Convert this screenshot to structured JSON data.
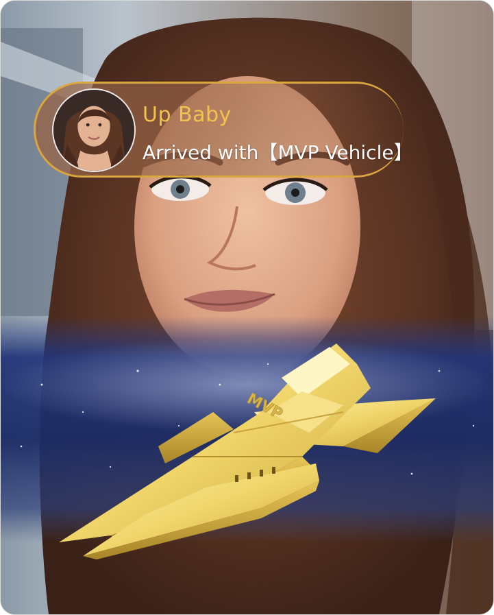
{
  "entry_notice": {
    "user_name": "Up Baby",
    "message": "Arrived with【MVP Vehicle】"
  },
  "vehicle": {
    "hull_marking": "MVP",
    "icon": "spaceship-icon"
  },
  "colors": {
    "banner_border": "#d9a640",
    "user_name": "#f3c24c",
    "message": "#ffffff",
    "vehicle_gold": "#f2de78",
    "nebula_blue": "#1e2f6e"
  }
}
